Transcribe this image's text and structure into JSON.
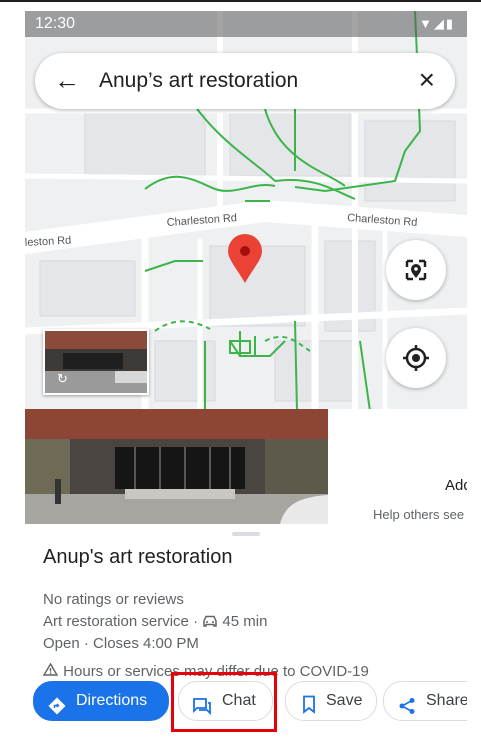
{
  "status_bar": {
    "time": "12:30"
  },
  "search": {
    "query": "Anup’s art restoration"
  },
  "map": {
    "road_labels": [
      "Charleston Rd",
      "Charleston Rd",
      "leston Rd"
    ]
  },
  "photo_panel": {
    "add_label": "Add",
    "help_text": "Help others see"
  },
  "place": {
    "name": "Anup's art restoration",
    "ratings": "No ratings or reviews",
    "category": "Art restoration service",
    "separator": "·",
    "drive_time": "45 min",
    "hours": "Open · Closes 4:00 PM",
    "covid_notice": "Hours or services may differ due to COVID-19"
  },
  "actions": {
    "directions": "Directions",
    "chat": "Chat",
    "save": "Save",
    "share": "Share"
  },
  "colors": {
    "accent": "#1a73e8",
    "pin": "#ea4335",
    "highlight": "#e8000b",
    "paths": "#3bb54a"
  }
}
